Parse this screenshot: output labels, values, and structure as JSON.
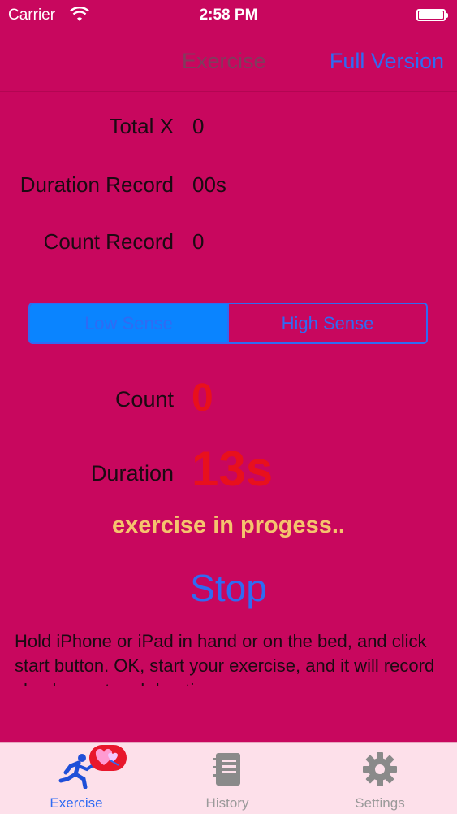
{
  "status_bar": {
    "carrier": "Carrier",
    "time": "2:58 PM",
    "wifi_icon": "wifi-icon",
    "battery_icon": "battery-icon"
  },
  "nav": {
    "title": "Exercise",
    "full_version_label": "Full Version"
  },
  "records": [
    {
      "label": "Total X",
      "value": "0"
    },
    {
      "label": "Duration Record",
      "value": "00s"
    },
    {
      "label": "Count Record",
      "value": "0"
    }
  ],
  "sensitivity": {
    "options": [
      "Low Sense",
      "High Sense"
    ],
    "selected": "Low Sense"
  },
  "current": {
    "count_label": "Count",
    "count_value": "0",
    "duration_label": "Duration",
    "duration_value": "13s"
  },
  "status_text": "exercise in progess..",
  "stop_label": "Stop",
  "instructions": "Hold iPhone or iPad in hand or on the bed, and click start button. OK, start your exercise, and it will record shock count and duration",
  "tabs": [
    {
      "label": "Exercise",
      "icon": "running-person-icon",
      "active": true
    },
    {
      "label": "History",
      "icon": "notebook-icon",
      "active": false
    },
    {
      "label": "Settings",
      "icon": "gear-icon",
      "active": false
    }
  ],
  "badge_icon": "hearts-icon",
  "colors": {
    "background": "#c8075e",
    "accent_blue": "#2f6bf3",
    "value_red": "#e8101d",
    "status_yellow": "#f5c36e",
    "tab_bar": "#fde0ea"
  }
}
